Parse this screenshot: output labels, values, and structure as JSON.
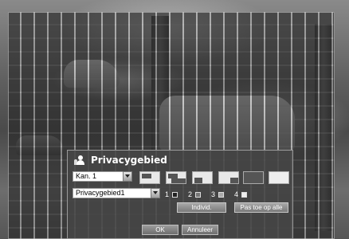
{
  "dialog": {
    "title": "Privacygebied",
    "icon": "privacy-person-icon"
  },
  "channel_select": {
    "value": "Kan. 1"
  },
  "area_select": {
    "value": "Privacygebied1"
  },
  "channels": [
    {
      "label": "1",
      "color": "#222222"
    },
    {
      "label": "2",
      "color": "#777777"
    },
    {
      "label": "3",
      "color": "#aaaaaa"
    },
    {
      "label": "4",
      "color": "#eeeeee"
    }
  ],
  "buttons": {
    "individual": "Individ.",
    "apply_all": "Pas toe op alle",
    "ok": "OK",
    "cancel": "Annuleer"
  }
}
